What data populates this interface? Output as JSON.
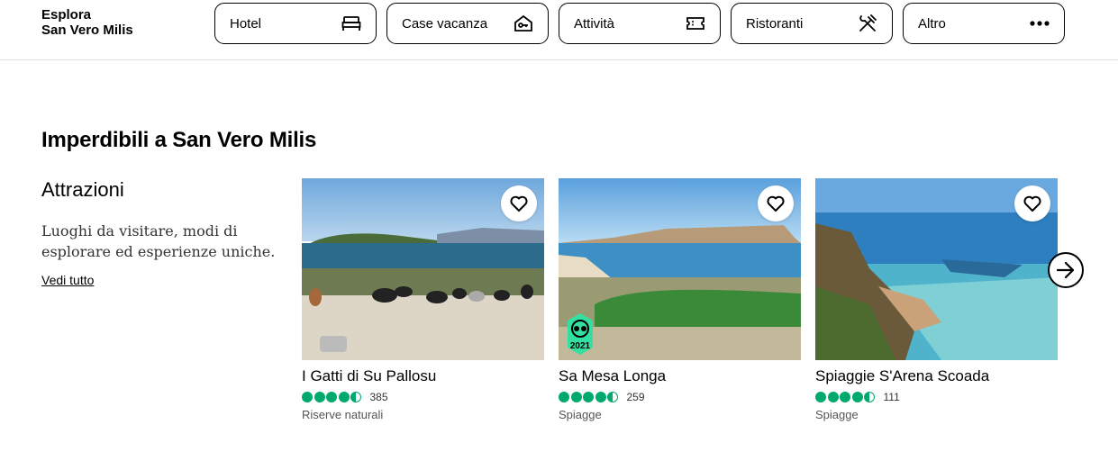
{
  "header": {
    "brand_line1": "Esplora",
    "brand_line2": "San Vero Milis",
    "nav": [
      {
        "label": "Hotel",
        "icon": "bed-icon"
      },
      {
        "label": "Case vacanza",
        "icon": "house-key-icon"
      },
      {
        "label": "Attività",
        "icon": "ticket-icon"
      },
      {
        "label": "Ristoranti",
        "icon": "fork-knife-icon"
      },
      {
        "label": "Altro",
        "icon": "more-dots-icon"
      }
    ]
  },
  "main": {
    "title": "Imperdibili a San Vero Milis",
    "section_title": "Attrazioni",
    "description": "Luoghi da visitare, modi di esplorare ed esperienze uniche.",
    "see_all": "Vedi tutto",
    "cards": [
      {
        "title": "I Gatti di Su Pallosu",
        "rating": 4.5,
        "reviews": "385",
        "category": "Riserve naturali",
        "badge": ""
      },
      {
        "title": "Sa Mesa Longa",
        "rating": 4.5,
        "reviews": "259",
        "category": "Spiagge",
        "badge": "2021"
      },
      {
        "title": "Spiaggie S'Arena Scoada",
        "rating": 4.5,
        "reviews": "111",
        "category": "Spiagge",
        "badge": ""
      }
    ]
  },
  "colors": {
    "rating_green": "#00aa6c",
    "border": "#000000"
  }
}
